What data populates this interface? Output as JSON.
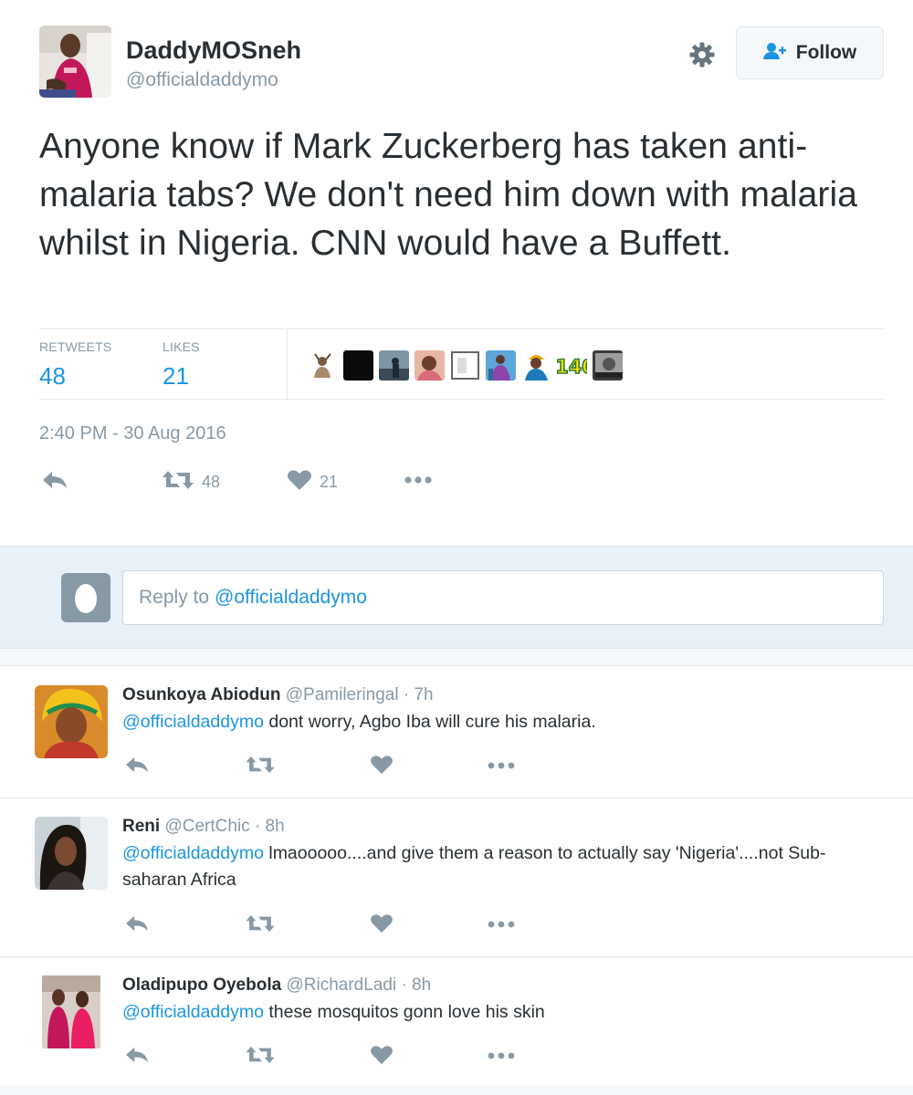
{
  "tweet": {
    "author_name": "DaddyMOSneh",
    "author_handle": "@officialdaddymo",
    "follow_label": "Follow",
    "text": "Anyone know if Mark Zuckerberg has taken anti-malaria tabs? We don't need him down with malaria whilst in Nigeria. CNN would have a Buffett.",
    "stats": {
      "retweets_label": "RETWEETS",
      "retweets": "48",
      "likes_label": "LIKES",
      "likes": "21",
      "liker_badge": "140"
    },
    "timestamp": "2:40 PM - 30 Aug 2016",
    "actions": {
      "retweet_count": "48",
      "like_count": "21"
    }
  },
  "reply_box": {
    "prefix": "Reply to",
    "mention": "@officialdaddymo"
  },
  "replies": [
    {
      "name": "Osunkoya Abiodun",
      "handle": "@Pamileringal",
      "time": "· 7h",
      "mention": "@officialdaddymo",
      "text": "  dont worry, Agbo Iba will cure his malaria."
    },
    {
      "name": "Reni",
      "handle": "@CertChic",
      "time": "· 8h",
      "mention": "@officialdaddymo",
      "text": " lmaooooo....and give them a reason to actually say 'Nigeria'....not Sub-saharan Africa"
    },
    {
      "name": "Oladipupo Oyebola",
      "handle": "@RichardLadi",
      "time": "· 8h",
      "mention": "@officialdaddymo",
      "text": " these mosquitos gonn love his skin"
    }
  ],
  "colors": {
    "link": "#1b95e0",
    "muted": "#8899a6",
    "text": "#292f33",
    "reply_band": "#e8f1f8",
    "divider": "#e1e8ed"
  },
  "icons": [
    "gear-icon",
    "follow-user-icon",
    "reply-icon",
    "retweet-icon",
    "heart-icon",
    "more-icon",
    "egg-avatar-icon"
  ]
}
